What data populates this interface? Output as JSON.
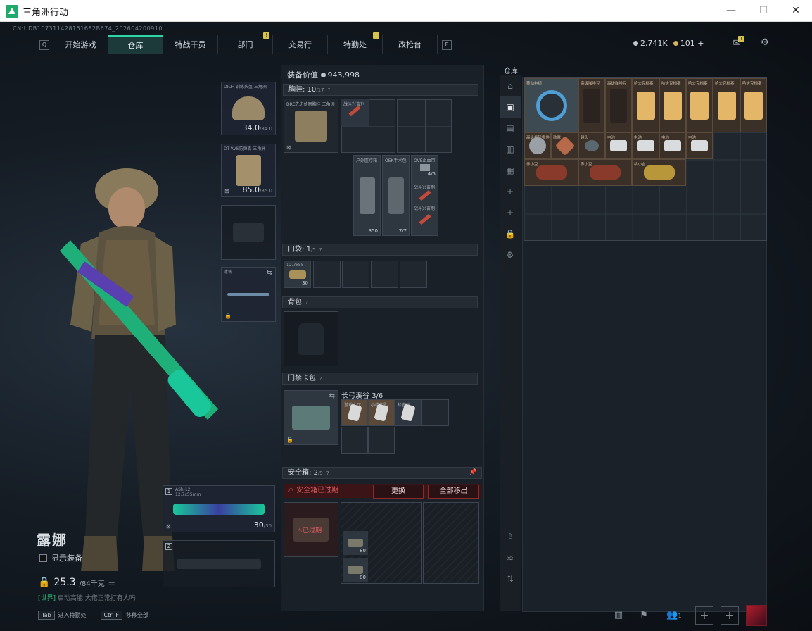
{
  "window": {
    "title": "三角洲行动",
    "min": "—",
    "max": "☐",
    "close": "✕"
  },
  "uid": "CN:UDB107311428151682B674_202604200910",
  "nav": {
    "left_key": "Q",
    "right_key": "E",
    "tabs": [
      {
        "label": "开始游戏",
        "active": false,
        "alert": false
      },
      {
        "label": "仓库",
        "active": true,
        "alert": false
      },
      {
        "label": "特战干员",
        "active": false,
        "alert": false
      },
      {
        "label": "部门",
        "active": false,
        "alert": true
      },
      {
        "label": "交易行",
        "active": false,
        "alert": false
      },
      {
        "label": "特勤处",
        "active": false,
        "alert": true
      },
      {
        "label": "改枪台",
        "active": false,
        "alert": false
      }
    ],
    "alert_mark": "!"
  },
  "currency": {
    "silver": "2,741K",
    "gold": "101",
    "gold_add": "+"
  },
  "gear": {
    "helmet": {
      "label": "DICH 训练头盔 三角洲",
      "value": "34.0",
      "max": "/34.0"
    },
    "armor": {
      "label": "DT-AVS防弹衣 三角洲",
      "value": "85.0",
      "max": "/85.0"
    },
    "melee": {
      "label": "冰镐"
    },
    "primary": {
      "index": "1",
      "name": "ASh-12",
      "caliber": "12.7x55mm",
      "ammo": "30",
      "ammo_max": "/30"
    },
    "secondary": {
      "index": "2"
    }
  },
  "character": {
    "name": "露娜",
    "show_equip": "显示装备",
    "weight": "25.3",
    "weight_max": "/84千克"
  },
  "chat": {
    "tag": "[世界]",
    "text": "启动高能 大佬正常打有人吗"
  },
  "hotkeys": [
    {
      "key": "Tab",
      "label": "进入特勤处"
    },
    {
      "key": "Ctrl F",
      "label": "移移全部"
    }
  ],
  "equipment": {
    "value_label": "装备价值",
    "value": "943,998",
    "chest": {
      "label": "胸挂:",
      "count": "10",
      "cap": "/17",
      "rig_label": "DRC先进侦察胸挂 三角洲",
      "item1": "战斗兴奋剂"
    },
    "pouch_items": [
      {
        "label": "户外医疗箱",
        "num": "350"
      },
      {
        "label": "OEK手术包",
        "num": "7/7"
      },
      {
        "label": "OVE止血带",
        "num": "4/5"
      }
    ],
    "stim2": "战斗兴奋剂",
    "stim3": "战斗兴奋剂",
    "pocket": {
      "label": "口袋:",
      "count": "1",
      "cap": "/5",
      "ammo_label": "12.7x55",
      "ammo_num": "30"
    },
    "backpack": {
      "label": "背包"
    },
    "keycard": {
      "label": "门禁卡包",
      "map": "长弓溪谷",
      "count": "3/6",
      "cards": [
        "游戏大厅",
        "小楼钥匙",
        "检查站"
      ]
    },
    "safe": {
      "label": "安全箱:",
      "count": "2",
      "cap": "/9",
      "expired": "安全箱已过期",
      "replace": "更换",
      "move_all": "全部移出",
      "expired_short": "已过期",
      "item1": "80",
      "item2": "80"
    },
    "help": "?"
  },
  "warehouse": {
    "label": "仓库",
    "items": [
      {
        "label": "移动电缆"
      },
      {
        "label": "高级咖啡豆"
      },
      {
        "label": "高级咖啡豆"
      },
      {
        "label": "哈夫克档案"
      },
      {
        "label": "哈夫克档案"
      },
      {
        "label": "哈夫克档案"
      },
      {
        "label": "哈夫克档案"
      },
      {
        "label": "哈夫克档案"
      },
      {
        "label": "高级齿轮零件"
      },
      {
        "label": "勋章"
      },
      {
        "label": "镜头"
      },
      {
        "label": "电池"
      },
      {
        "label": "电池"
      },
      {
        "label": "电池"
      },
      {
        "label": "电池"
      },
      {
        "label": "赤小豆"
      },
      {
        "label": "赤小豆"
      },
      {
        "label": "桃小吉"
      }
    ]
  },
  "bottom": {
    "player_count": "1",
    "plus": "+"
  }
}
